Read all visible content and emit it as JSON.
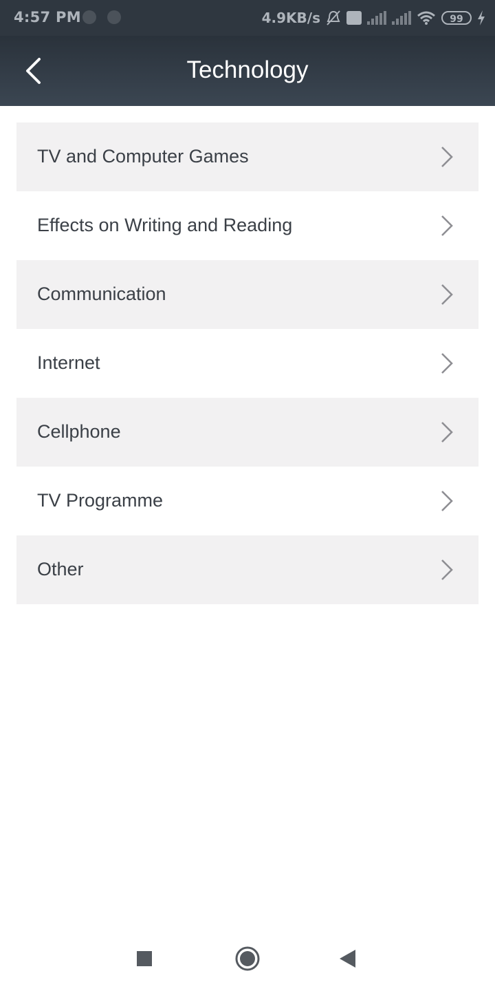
{
  "status_bar": {
    "time": "4:57 PM",
    "speed": "4.9KB/s",
    "battery": "99",
    "icons": [
      "notification-dot-icon",
      "notification-dot-icon",
      "mute-bell-icon",
      "volte-icon",
      "signal-icon",
      "signal-icon",
      "wifi-icon",
      "battery-icon",
      "charging-icon"
    ]
  },
  "header": {
    "title": "Technology",
    "back_icon": "chevron-left-icon"
  },
  "categories": [
    {
      "label": "TV and Computer Games"
    },
    {
      "label": "Effects on Writing and Reading"
    },
    {
      "label": "Communication"
    },
    {
      "label": "Internet"
    },
    {
      "label": "Cellphone"
    },
    {
      "label": "TV Programme"
    },
    {
      "label": "Other"
    }
  ],
  "nav_bar": {
    "icons": [
      "recents-square-icon",
      "home-circle-icon",
      "back-triangle-icon"
    ]
  },
  "colors": {
    "header_top": "#2a323b",
    "header_bottom": "#3b4652",
    "row_alt": "#f2f1f2",
    "text": "#3b4047",
    "chevron": "#8e8e93"
  }
}
